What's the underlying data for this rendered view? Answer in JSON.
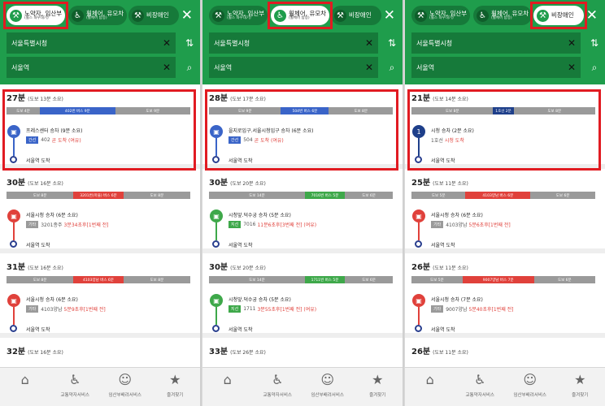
{
  "colors": {
    "header": "#1f9d4c",
    "header_dark": "#167a3a",
    "walk": "#9a9a9a",
    "bus_blue": "#3a64c8",
    "bus_red": "#e0413b",
    "bus_green": "#3ea84a",
    "subway_line1": "#1e3f8a",
    "highlight": "#e11b22",
    "arrival": "#e0413b"
  },
  "panels": [
    {
      "active_mode": 0,
      "modes": [
        {
          "label": "노약자, 임산부",
          "sub": "(휠스 좌우대기)",
          "icon": "walk-cane-icon"
        },
        {
          "label": "휠체어, 유모차",
          "sub": "(휠체어 탑승)",
          "icon": "wheelchair-icon"
        },
        {
          "label": "비장애인",
          "sub": "",
          "icon": "walk-icon"
        }
      ],
      "from": "서울특별시청",
      "to": "서울역",
      "routes": [
        {
          "title": "27분",
          "sub": "(도보 13분 소요)",
          "highlight": true,
          "segments": [
            {
              "label": "도보 4분",
              "kind": "walk",
              "w": 4
            },
            {
              "label": "402번 버스 9분",
              "kind": "bus_blue",
              "w": 9
            },
            {
              "label": "도보 9분",
              "kind": "walk",
              "w": 9
            }
          ],
          "stop_icon": "bus-icon",
          "stop_color": "bus_blue",
          "stop": "프레스센터 승차 (9분 소요)",
          "tag": "간선",
          "tag_color": "bus_blue",
          "line": "402",
          "arrival": "곧 도착 (여유)",
          "dest": "서울역 도착"
        },
        {
          "title": "30분",
          "sub": "(도보 16분 소요)",
          "highlight": false,
          "segments": [
            {
              "label": "도보 8분",
              "kind": "walk",
              "w": 8
            },
            {
              "label": "3201번(마을) 버스 6분",
              "kind": "bus_red",
              "w": 6
            },
            {
              "label": "도보 8분",
              "kind": "walk",
              "w": 8
            }
          ],
          "stop_icon": "bus-icon",
          "stop_color": "bus_red",
          "stop": "서울시청 승차 (6분 소요)",
          "tag": "기타",
          "tag_color": "walk",
          "line": "3201종주",
          "arrival": "3분34초후[1번째 전]",
          "dest": "서울역 도착"
        },
        {
          "title": "31분",
          "sub": "(도보 16분 소요)",
          "highlight": false,
          "segments": [
            {
              "label": "도보 8분",
              "kind": "walk",
              "w": 8
            },
            {
              "label": "4103양남 버스 6분",
              "kind": "bus_red",
              "w": 6
            },
            {
              "label": "도보 8분",
              "kind": "walk",
              "w": 8
            }
          ],
          "stop_icon": "bus-icon",
          "stop_color": "bus_red",
          "stop": "서울시청 승차 (6분 소요)",
          "tag": "기타",
          "tag_color": "walk",
          "line": "4103양남",
          "arrival": "5분9초후[1번째 전]",
          "dest": "서울역 도착"
        },
        {
          "title": "32분",
          "sub": "(도보 16분 소요)",
          "highlight": false,
          "segments": []
        }
      ]
    },
    {
      "active_mode": 1,
      "modes": [
        {
          "label": "노약자, 임산부",
          "sub": "(휠스 좌우대기)",
          "icon": "walk-cane-icon"
        },
        {
          "label": "휠체어, 유모차",
          "sub": "(휠체어 탑승)",
          "icon": "wheelchair-icon"
        },
        {
          "label": "비장애인",
          "sub": "",
          "icon": "walk-icon"
        }
      ],
      "from": "서울특별시청",
      "to": "서울역",
      "routes": [
        {
          "title": "28분",
          "sub": "(도보 17분 소요)",
          "highlight": true,
          "segments": [
            {
              "label": "도보 9분",
              "kind": "walk",
              "w": 9
            },
            {
              "label": "504번 버스 6분",
              "kind": "bus_blue",
              "w": 6
            },
            {
              "label": "도보 8분",
              "kind": "walk",
              "w": 8
            }
          ],
          "stop_icon": "bus-icon",
          "stop_color": "bus_blue",
          "stop": "을지로입구.서울시청입구 승차 (6분 소요)",
          "tag": "간선",
          "tag_color": "bus_blue",
          "line": "504",
          "arrival": "곧 도착 (여유)",
          "dest": "서울역 도착"
        },
        {
          "title": "30분",
          "sub": "(도보 20분 소요)",
          "highlight": false,
          "segments": [
            {
              "label": "도보 14분",
              "kind": "walk",
              "w": 12
            },
            {
              "label": "7016번 버스 5분",
              "kind": "bus_green",
              "w": 5
            },
            {
              "label": "도보 6분",
              "kind": "walk",
              "w": 6
            }
          ],
          "stop_icon": "bus-icon",
          "stop_color": "bus_green",
          "stop": "시청앞.덕수궁 승차 (5분 소요)",
          "tag": "지선",
          "tag_color": "bus_green",
          "line": "7016",
          "arrival": "11분6초후[3번째 전] (여유)",
          "dest": "서울역 도착"
        },
        {
          "title": "30분",
          "sub": "(도보 20분 소요)",
          "highlight": false,
          "segments": [
            {
              "label": "도보 14분",
              "kind": "walk",
              "w": 12
            },
            {
              "label": "1711번 버스 5분",
              "kind": "bus_green",
              "w": 5
            },
            {
              "label": "도보 6분",
              "kind": "walk",
              "w": 6
            }
          ],
          "stop_icon": "bus-icon",
          "stop_color": "bus_green",
          "stop": "시청앞.덕수궁 승차 (5분 소요)",
          "tag": "지선",
          "tag_color": "bus_green",
          "line": "1711",
          "arrival": "3분55초후[1번째 전] (여유)",
          "dest": "서울역 도착"
        },
        {
          "title": "33분",
          "sub": "(도보 26분 소요)",
          "highlight": false,
          "segments": []
        }
      ]
    },
    {
      "active_mode": 2,
      "modes": [
        {
          "label": "노약자, 임산부",
          "sub": "(휠스 좌우대기)",
          "icon": "walk-cane-icon"
        },
        {
          "label": "휠체어, 유모차",
          "sub": "(휠체어 탑승)",
          "icon": "wheelchair-icon"
        },
        {
          "label": "비장애인",
          "sub": "",
          "icon": "walk-icon"
        }
      ],
      "from": "서울특별시청",
      "to": "서울역",
      "routes": [
        {
          "title": "21분",
          "sub": "(도보 14분 소요)",
          "highlight": true,
          "segments": [
            {
              "label": "도보 8분",
              "kind": "walk",
              "w": 8
            },
            {
              "label": "1호선 2분",
              "kind": "subway_line1",
              "w": 2
            },
            {
              "label": "도보 8분",
              "kind": "walk",
              "w": 8
            }
          ],
          "stop_icon": "subway-line1-icon",
          "stop_color": "subway_line1",
          "stop_glyph": "1",
          "stop": "시청 승차 (2분 소요)",
          "tag": "",
          "tag_color": "walk",
          "line": "1호선",
          "arrival": "시청 도착",
          "dest": "서울역 도착"
        },
        {
          "title": "25분",
          "sub": "(도보 11분 소요)",
          "highlight": false,
          "segments": [
            {
              "label": "도보 5분",
              "kind": "walk",
              "w": 5
            },
            {
              "label": "4103양남 버스 6분",
              "kind": "bus_red",
              "w": 6
            },
            {
              "label": "도보 6분",
              "kind": "walk",
              "w": 6
            }
          ],
          "stop_icon": "bus-icon",
          "stop_color": "bus_red",
          "stop": "서울시청 승차 (6분 소요)",
          "tag": "기타",
          "tag_color": "walk",
          "line": "4103양남",
          "arrival": "5분6초후[1번째 전]",
          "dest": "서울역 도착"
        },
        {
          "title": "26분",
          "sub": "(도보 11분 소요)",
          "highlight": false,
          "segments": [
            {
              "label": "도보 5분",
              "kind": "walk",
              "w": 5
            },
            {
              "label": "9007양남 버스 7분",
              "kind": "bus_red",
              "w": 7
            },
            {
              "label": "도보 6분",
              "kind": "walk",
              "w": 6
            }
          ],
          "stop_icon": "bus-icon",
          "stop_color": "bus_red",
          "stop": "서울시청 승차 (7분 소요)",
          "tag": "기타",
          "tag_color": "walk",
          "line": "9007양남",
          "arrival": "5분40초후[1번째 전]",
          "dest": "서울역 도착"
        },
        {
          "title": "26분",
          "sub": "(도보 11분 소요)",
          "highlight": false,
          "segments": []
        }
      ]
    }
  ],
  "nav": [
    {
      "label": "",
      "icon": "home-icon"
    },
    {
      "label": "교통약자서비스",
      "icon": "wheelchair-icon"
    },
    {
      "label": "임산부배려서비스",
      "icon": "family-icon"
    },
    {
      "label": "즐겨찾기",
      "icon": "star-icon"
    }
  ]
}
